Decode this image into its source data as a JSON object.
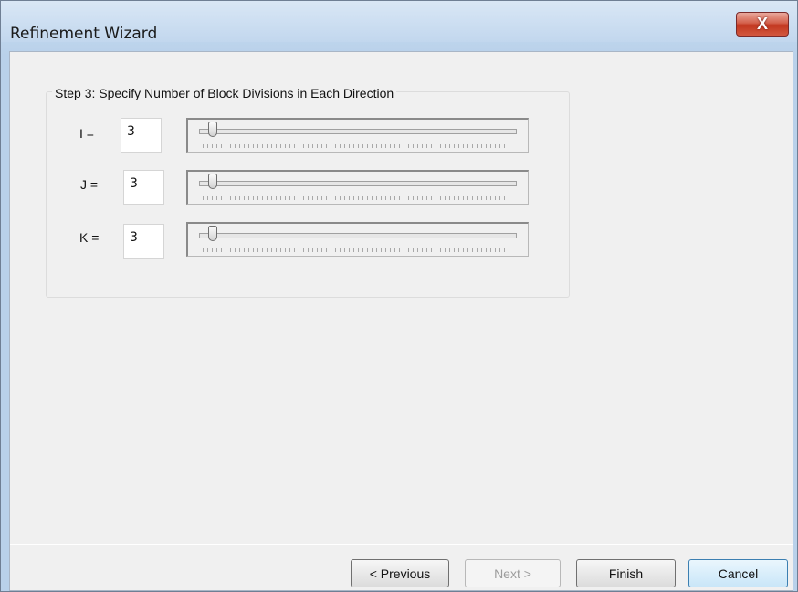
{
  "window": {
    "title": "Refinement Wizard",
    "close_glyph": "X"
  },
  "step": {
    "label": "Step 3: Specify Number of Block Divisions in Each Direction"
  },
  "divisions": [
    {
      "label": "I =",
      "value": "3",
      "slider_value": 3
    },
    {
      "label": "J =",
      "value": "3",
      "slider_value": 3
    },
    {
      "label": "K =",
      "value": "3",
      "slider_value": 3
    }
  ],
  "buttons": {
    "previous": "< Previous",
    "next": "Next >",
    "finish": "Finish",
    "cancel": "Cancel"
  },
  "colors": {
    "close_button": "#c2371f",
    "default_button_border": "#3c7fb1",
    "disabled_text": "#9c9c9c"
  },
  "icons": {
    "close": "close-icon"
  }
}
